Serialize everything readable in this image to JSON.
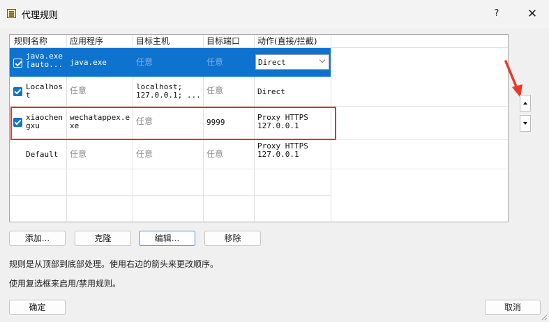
{
  "window": {
    "title": "代理规则",
    "help_label": "?",
    "close_label": "✕",
    "icon": "rules-list-icon"
  },
  "rules_table": {
    "headers": [
      "规则名称",
      "应用程序",
      "目标主机",
      "目标端口",
      "动作(直接/拦截)"
    ],
    "rows": [
      {
        "checked": true,
        "selected": true,
        "name": "java.exe\n[auto...",
        "application": "java.exe",
        "target_host": "任意",
        "target_port": "任意",
        "action": "Direct",
        "action_is_dropdown": true
      },
      {
        "checked": true,
        "selected": false,
        "name": "Localhos\nt",
        "application": "任意",
        "target_host": "localhost;\n127.0.0.1; ...",
        "target_port": "任意",
        "action": "Direct"
      },
      {
        "checked": true,
        "selected": false,
        "highlighted": true,
        "name": "xiaochen\ngxu",
        "application": "wechatappex.e\nxe",
        "target_host": "任意",
        "target_port": "9999",
        "action": "Proxy HTTPS\n127.0.0.1"
      },
      {
        "checked": false,
        "selected": false,
        "name": "Default",
        "application": "任意",
        "target_host": "任意",
        "target_port": "任意",
        "action": "Proxy HTTPS\n127.0.0.1"
      }
    ]
  },
  "side_buttons": {
    "move_up_icon": "triangle-up-icon",
    "move_down_icon": "triangle-down-icon"
  },
  "buttons": {
    "add": "添加...",
    "clone": "克隆",
    "edit": "编辑...",
    "remove": "移除",
    "ok": "确定",
    "cancel": "取消"
  },
  "notes": {
    "line1": "规则是从顶部到底部处理。使用右边的箭头来更改顺序。",
    "line2": "使用复选框来启用/禁用规则。"
  },
  "colors": {
    "selection": "#0e72cf",
    "highlight_border": "#e0332b",
    "annotation_arrow": "#e8392b"
  }
}
